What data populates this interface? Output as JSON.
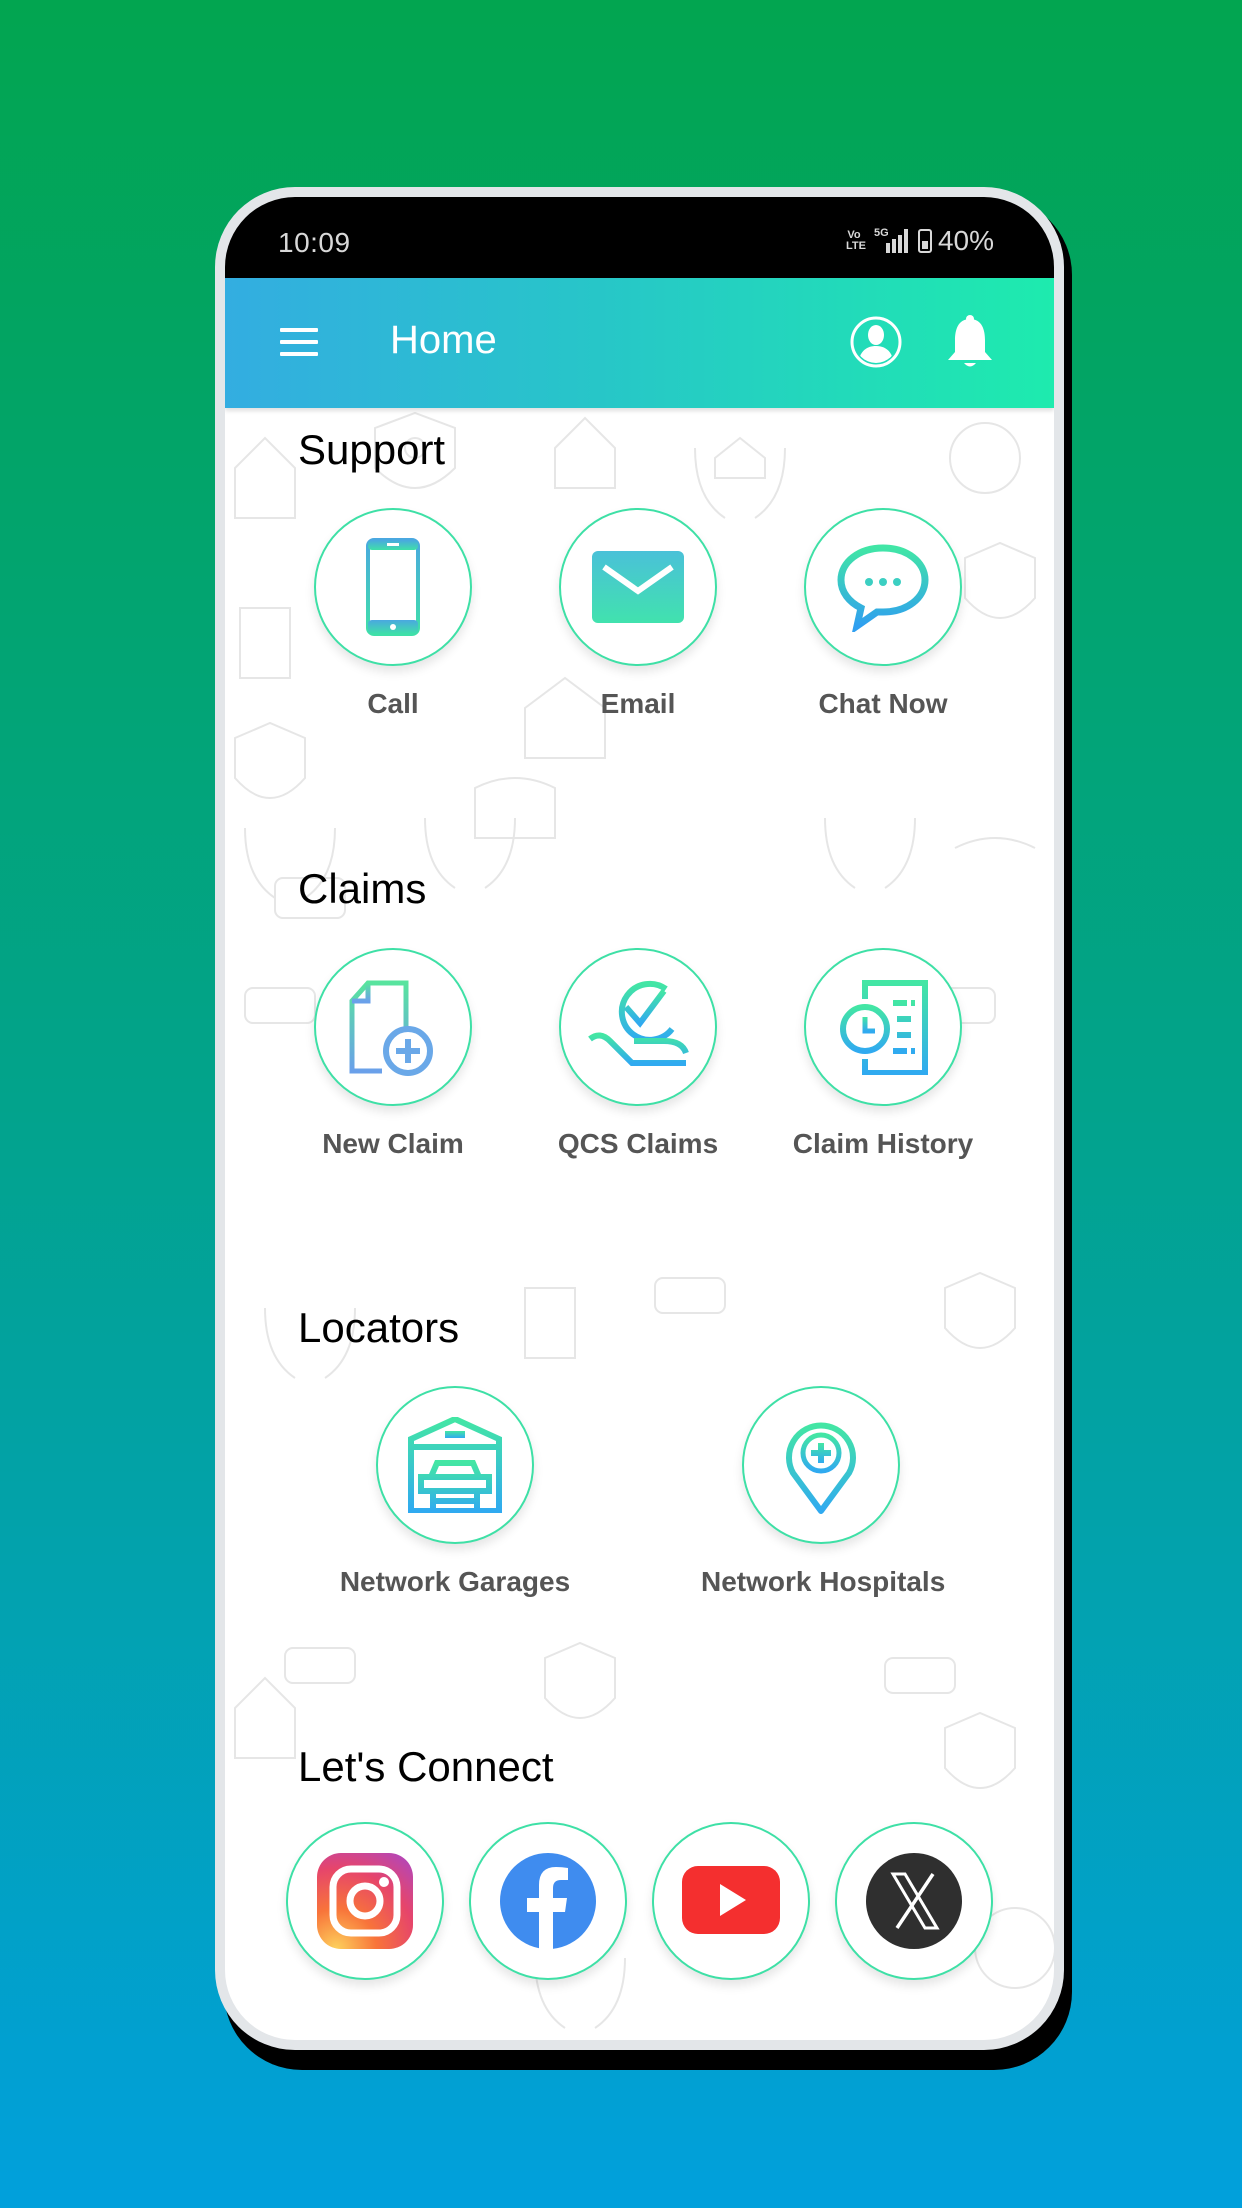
{
  "status_bar": {
    "time": "10:09",
    "volte_label": "Vo LTE",
    "network_label": "5G",
    "battery_percent": "40%"
  },
  "app_bar": {
    "title": "Home",
    "menu_icon": "hamburger-menu-icon",
    "profile_icon": "user-profile-icon",
    "notification_icon": "bell-icon"
  },
  "theme": {
    "accent_start": "#33ade1",
    "accent_end": "#1eebae",
    "circle_border": "#3ee0a6",
    "label_color": "#555555"
  },
  "sections": {
    "support": {
      "title": "Support",
      "items": [
        {
          "label": "Call",
          "icon": "phone-icon"
        },
        {
          "label": "Email",
          "icon": "envelope-icon"
        },
        {
          "label": "Chat Now",
          "icon": "chat-bubble-icon"
        }
      ]
    },
    "claims": {
      "title": "Claims",
      "items": [
        {
          "label": "New Claim",
          "icon": "document-add-icon"
        },
        {
          "label": "QCS Claims",
          "icon": "hand-check-icon"
        },
        {
          "label": "Claim History",
          "icon": "document-clock-icon"
        }
      ]
    },
    "locators": {
      "title": "Locators",
      "items": [
        {
          "label": "Network Garages",
          "icon": "garage-car-icon"
        },
        {
          "label": "Network Hospitals",
          "icon": "hospital-pin-icon"
        }
      ]
    },
    "connect": {
      "title": "Let's Connect",
      "items": [
        {
          "name": "Instagram",
          "icon": "instagram-icon"
        },
        {
          "name": "Facebook",
          "icon": "facebook-icon"
        },
        {
          "name": "YouTube",
          "icon": "youtube-icon"
        },
        {
          "name": "X",
          "icon": "x-twitter-icon"
        }
      ]
    }
  }
}
